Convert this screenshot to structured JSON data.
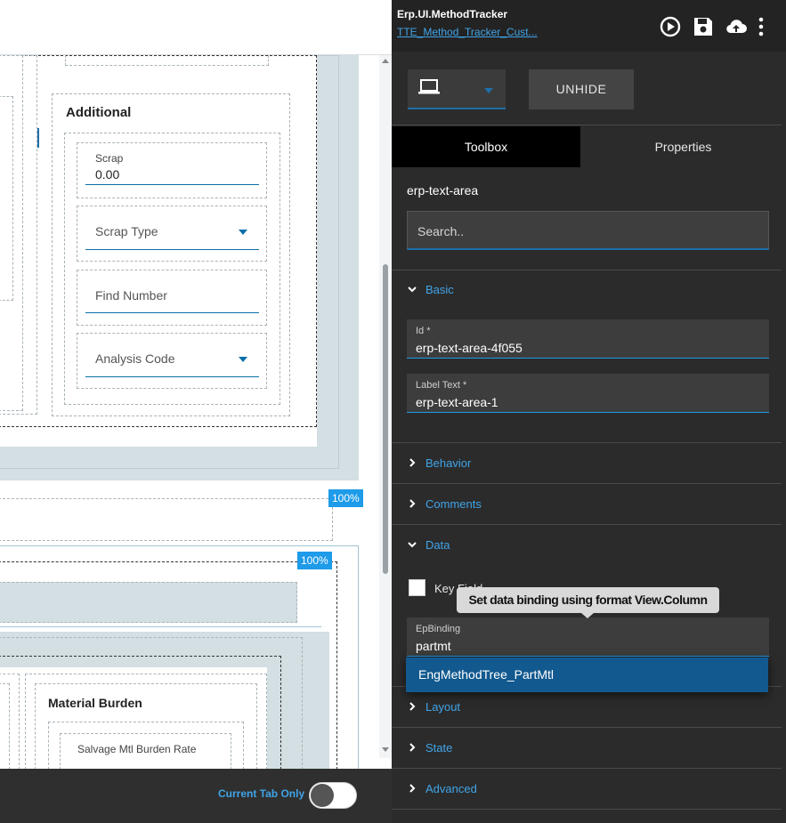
{
  "canvas": {
    "additional_title": "Additional",
    "scrap_label": "Scrap",
    "scrap_value": "0.00",
    "scrap_type_placeholder": "Scrap Type",
    "find_number_placeholder": "Find Number",
    "analysis_code_placeholder": "Analysis Code",
    "zoom_badge_1": "100%",
    "zoom_badge_2": "100%",
    "material_burden_title": "Material Burden",
    "salvage_label": "Salvage Mtl Burden Rate",
    "current_tab_only_label": "Current Tab Only"
  },
  "panel": {
    "app_title": "Erp.UI.MethodTracker",
    "layer_link": "TTE_Method_Tracker_Cust...",
    "icons": [
      "play-circle-icon",
      "save-icon",
      "cloud-upload-icon",
      "more-vertical-icon"
    ],
    "device_icon": "laptop-icon",
    "unhide_label": "UNHIDE",
    "tabs": [
      {
        "label": "Toolbox",
        "active": true
      },
      {
        "label": "Properties",
        "active": false
      }
    ],
    "component_name": "erp-text-area",
    "search_placeholder": "Search..",
    "sections": {
      "basic": "Basic",
      "behavior": "Behavior",
      "comments": "Comments",
      "data": "Data",
      "layout": "Layout",
      "state": "State",
      "advanced": "Advanced"
    },
    "id_field": {
      "label": "Id *",
      "value": "erp-text-area-4f055"
    },
    "label_text_field": {
      "label": "Label Text *",
      "value": "erp-text-area-1"
    },
    "key_field_label": "Key Field",
    "tooltip_text": "Set data binding using format View.Column",
    "ep_binding_field": {
      "label": "EpBinding",
      "value": "partmt"
    },
    "dropdown_option": "EngMethodTree_PartMtl"
  },
  "colors": {
    "accent": "#40a4e8",
    "panel_bg": "#2b2b2b",
    "field_underline": "#1e9be9",
    "dropdown_highlight": "#12598f",
    "zoom_badge": "#1e9be9"
  }
}
